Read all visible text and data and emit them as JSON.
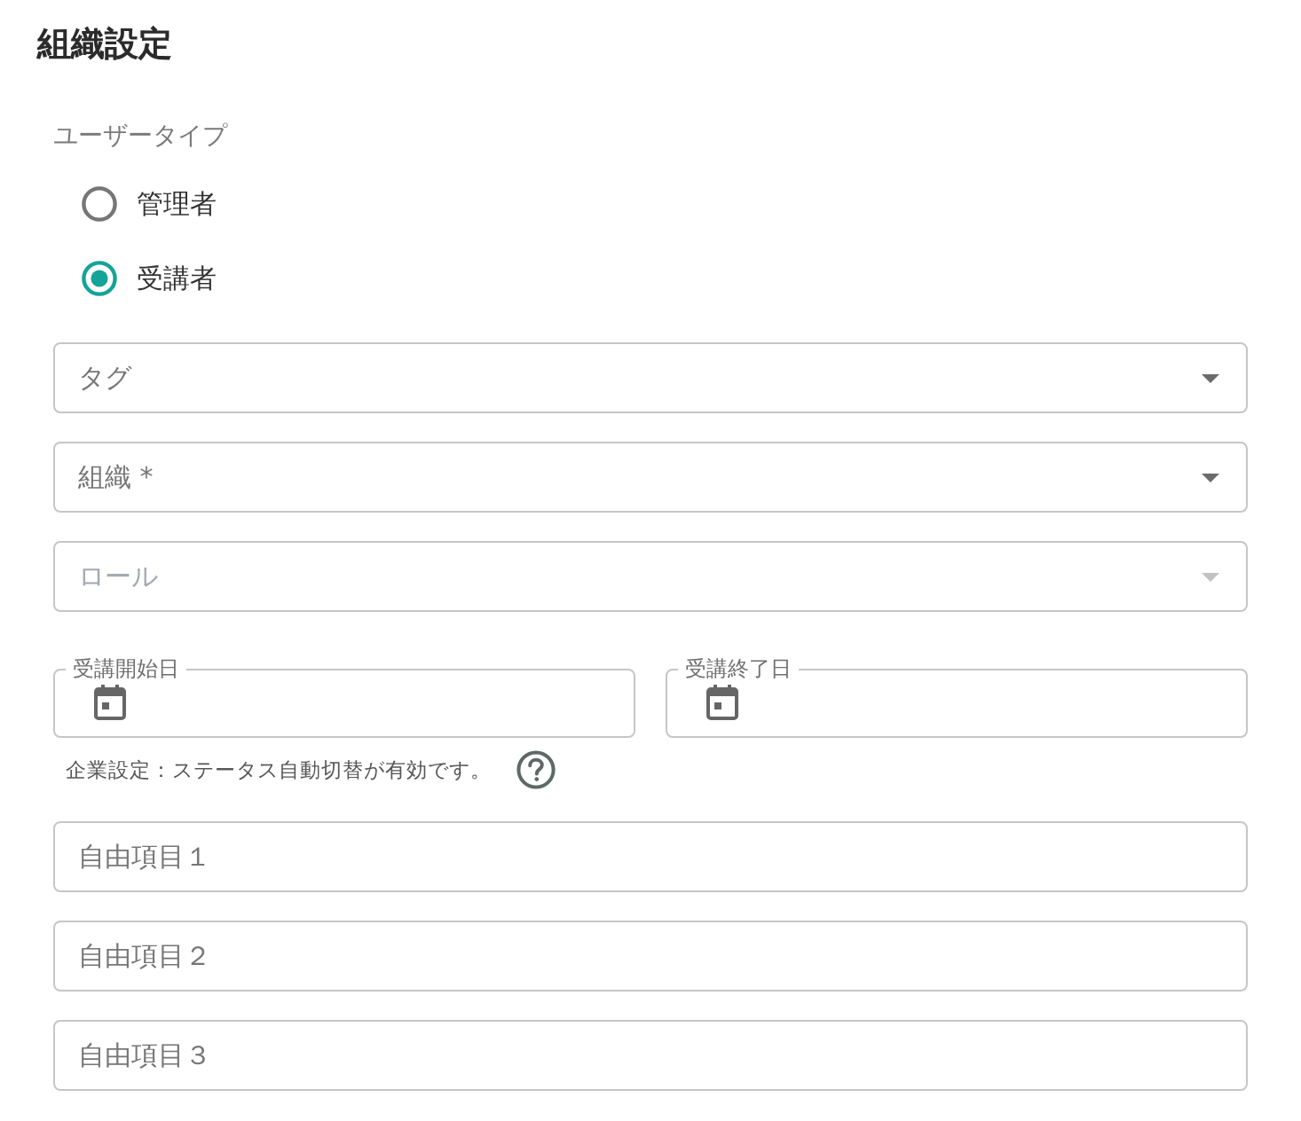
{
  "title": "組織設定",
  "user_type": {
    "label": "ユーザータイプ",
    "options": [
      {
        "label": "管理者",
        "selected": false
      },
      {
        "label": "受講者",
        "selected": true
      }
    ]
  },
  "selects": [
    {
      "placeholder": "タグ",
      "disabled": false
    },
    {
      "placeholder": "組織 *",
      "disabled": false
    },
    {
      "placeholder": "ロール",
      "disabled": true
    }
  ],
  "date_fields": [
    {
      "label": "受講開始日"
    },
    {
      "label": "受講終了日"
    }
  ],
  "notice": "企業設定：ステータス自動切替が有効です。",
  "free_fields": [
    {
      "placeholder": "自由項目１"
    },
    {
      "placeholder": "自由項目２"
    },
    {
      "placeholder": "自由項目３"
    }
  ]
}
